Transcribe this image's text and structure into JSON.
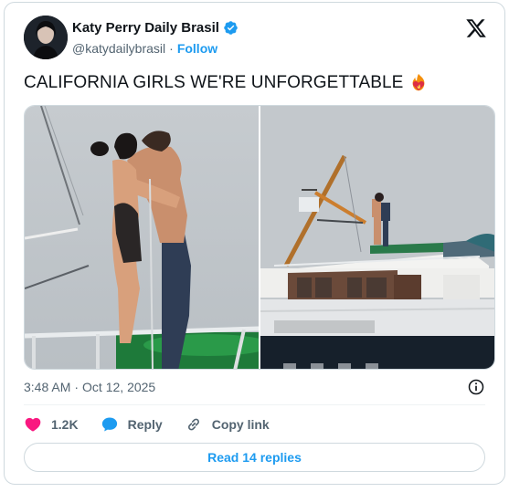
{
  "author": {
    "display_name": "Katy Perry Daily Brasil",
    "handle": "@katydailybrasil",
    "separator": "·",
    "follow_label": "Follow"
  },
  "tweet": {
    "text": "CALIFORNIA GIRLS WE'RE UNFORGETTABLE",
    "emoji": "heart-on-fire-icon",
    "time": "3:48 AM",
    "separator": "·",
    "date": "Oct 12, 2025"
  },
  "actions": {
    "likes_count": "1.2K",
    "reply_label": "Reply",
    "copy_link_label": "Copy link"
  },
  "read_replies_label": "Read 14 replies",
  "colors": {
    "accent": "#1d9bf0",
    "like": "#f91880",
    "secondary_text": "#536471"
  }
}
